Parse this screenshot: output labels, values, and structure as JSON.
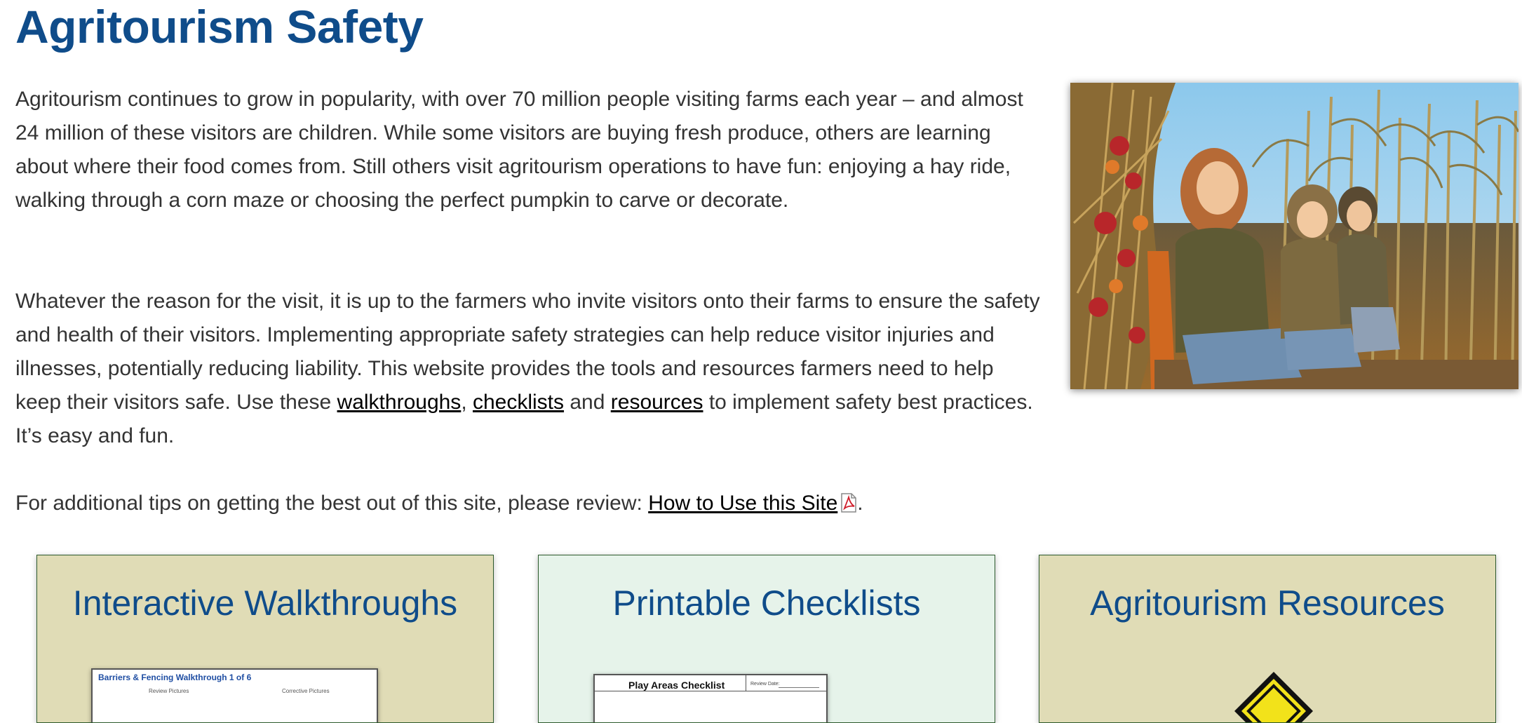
{
  "page": {
    "title": "Agritourism Safety"
  },
  "intro": {
    "paragraph1": "Agritourism continues to grow in popularity, with over 70 million people visiting farms each year – and almost 24 million of these visitors are children. While some visitors are buying fresh produce, others are learning about where their food comes from. Still others visit agritourism operations to have fun: enjoying a hay ride, walking through a corn maze or choosing the perfect pumpkin to carve or decorate.",
    "paragraph2_before": "Whatever the reason for the visit, it is up to the farmers who invite visitors onto their farms to ensure the safety and health of their visitors. Implementing appropriate safety strategies can help reduce visitor injuries and illnesses, potentially reducing liability. This website provides the tools and resources farmers need to help keep their visitors safe. Use these ",
    "link_walkthroughs": "walkthroughs",
    "comma": ", ",
    "link_checklists": "checklists",
    "and": " and ",
    "link_resources": "resources",
    "paragraph2_after": " to implement safety best practices. It’s easy and fun.",
    "tips_before": "For additional tips on getting the best out of this site, please review: ",
    "link_how_to": "How to Use this Site",
    "tips_after": "."
  },
  "hero_image": {
    "alt": "Children sitting on a hay wagon in front of a corn field"
  },
  "cards": [
    {
      "title": "Interactive Walkthroughs",
      "thumb_title": "Barriers & Fencing Walkthrough 1 of 6",
      "thumb_col_a": "Review Pictures",
      "thumb_col_b": "Corrective Pictures"
    },
    {
      "title": "Printable Checklists",
      "thumb_title": "Play Areas Checklist",
      "thumb_sub": "Review Date:"
    },
    {
      "title": "Agritourism Resources"
    }
  ],
  "colors": {
    "heading_blue": "#0f4c8a",
    "card_tan": "#e0dcb6",
    "card_mint": "#e6f3ea",
    "card_border": "#2d5a2d"
  },
  "icons": {
    "pdf": "pdf-icon"
  }
}
